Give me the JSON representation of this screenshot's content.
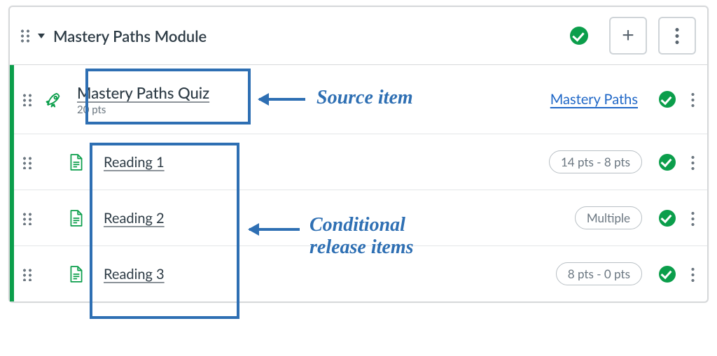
{
  "colors": {
    "accent_green": "#0b9e4b",
    "annotation_blue": "#2e6fb3",
    "link_blue": "#1f67c7"
  },
  "module": {
    "title": "Mastery Paths Module",
    "published": true
  },
  "header_icons": {
    "drag": "drag-handle-icon",
    "expand": "chevron-down-icon",
    "status": "check-icon",
    "add": "+",
    "menu": "kebab-icon"
  },
  "items": [
    {
      "icon": "rocket-quiz-icon",
      "title": "Mastery Paths Quiz",
      "subtitle": "20 pts",
      "right_link": "Mastery Paths",
      "pill": null,
      "published": true
    },
    {
      "icon": "page-icon",
      "title": "Reading 1",
      "subtitle": null,
      "right_link": null,
      "pill": "14 pts - 8 pts",
      "published": true
    },
    {
      "icon": "page-icon",
      "title": "Reading 2",
      "subtitle": null,
      "right_link": null,
      "pill": "Multiple",
      "published": true
    },
    {
      "icon": "page-icon",
      "title": "Reading 3",
      "subtitle": null,
      "right_link": null,
      "pill": "8 pts - 0 pts",
      "published": true
    }
  ],
  "annotations": {
    "source_label": "Source item",
    "conditional_label_line1": "Conditional",
    "conditional_label_line2": "release items"
  }
}
